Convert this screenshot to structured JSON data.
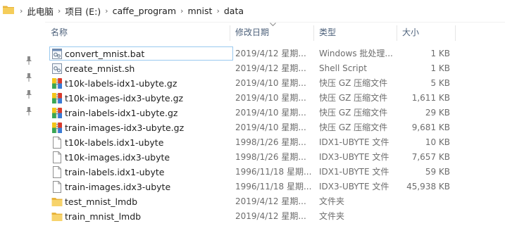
{
  "address": {
    "crumbs": [
      "此电脑",
      "项目 (E:)",
      "caffe_program",
      "mnist",
      "data"
    ]
  },
  "columns": {
    "name": "名称",
    "date": "修改日期",
    "type": "类型",
    "size": "大小"
  },
  "files": [
    {
      "name": "convert_mnist.bat",
      "date": "2019/4/12 星期...",
      "type": "Windows 批处理...",
      "size": "1 KB",
      "icon": "batch-file-icon"
    },
    {
      "name": "create_mnist.sh",
      "date": "2019/4/12 星期...",
      "type": "Shell Script",
      "size": "1 KB",
      "icon": "shell-script-icon"
    },
    {
      "name": "t10k-labels-idx1-ubyte.gz",
      "date": "2019/4/10 星期...",
      "type": "快压 GZ 压缩文件",
      "size": "5 KB",
      "icon": "archive-icon"
    },
    {
      "name": "t10k-images-idx3-ubyte.gz",
      "date": "2019/4/10 星期...",
      "type": "快压 GZ 压缩文件",
      "size": "1,611 KB",
      "icon": "archive-icon"
    },
    {
      "name": "train-labels-idx1-ubyte.gz",
      "date": "2019/4/10 星期...",
      "type": "快压 GZ 压缩文件",
      "size": "29 KB",
      "icon": "archive-icon"
    },
    {
      "name": "train-images-idx3-ubyte.gz",
      "date": "2019/4/10 星期...",
      "type": "快压 GZ 压缩文件",
      "size": "9,681 KB",
      "icon": "archive-icon"
    },
    {
      "name": "t10k-labels.idx1-ubyte",
      "date": "1998/1/26 星期...",
      "type": "IDX1-UBYTE 文件",
      "size": "10 KB",
      "icon": "blank-file-icon"
    },
    {
      "name": "t10k-images.idx3-ubyte",
      "date": "1998/1/26 星期...",
      "type": "IDX3-UBYTE 文件",
      "size": "7,657 KB",
      "icon": "blank-file-icon"
    },
    {
      "name": "train-labels.idx1-ubyte",
      "date": "1996/11/18 星期...",
      "type": "IDX1-UBYTE 文件",
      "size": "59 KB",
      "icon": "blank-file-icon"
    },
    {
      "name": "train-images.idx3-ubyte",
      "date": "1996/11/18 星期...",
      "type": "IDX3-UBYTE 文件",
      "size": "45,938 KB",
      "icon": "blank-file-icon"
    },
    {
      "name": "test_mnist_lmdb",
      "date": "2019/4/12 星期...",
      "type": "文件夹",
      "size": "",
      "icon": "folder-icon"
    },
    {
      "name": "train_mnist_lmdb",
      "date": "2019/4/12 星期...",
      "type": "文件夹",
      "size": "",
      "icon": "folder-icon"
    }
  ],
  "colors": {
    "header_text": "#4c607a",
    "folder": "#f5c84c",
    "selection_border": "#99c9ef"
  }
}
